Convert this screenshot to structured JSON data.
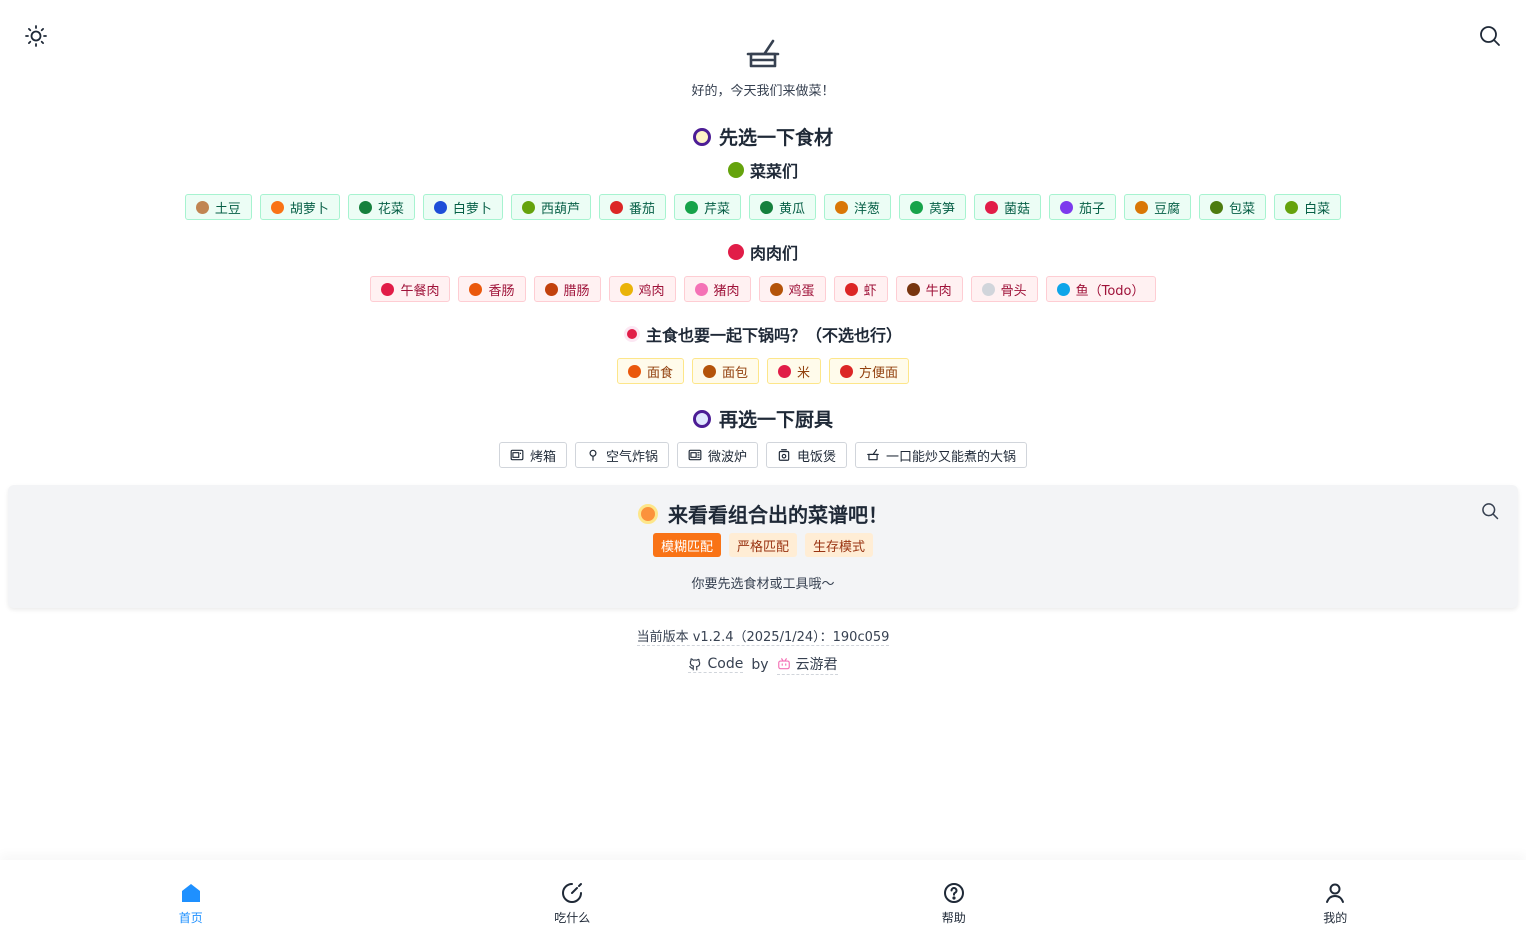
{
  "header": {
    "subtitle": "好的，今天我们来做菜！"
  },
  "ingredients": {
    "title": "先选一下食材",
    "vegetables": {
      "title": "菜菜们",
      "items": [
        "土豆",
        "胡萝卜",
        "花菜",
        "白萝卜",
        "西葫芦",
        "番茄",
        "芹菜",
        "黄瓜",
        "洋葱",
        "莴笋",
        "菌菇",
        "茄子",
        "豆腐",
        "包菜",
        "白菜"
      ],
      "icon_colors": [
        "#c08552",
        "#f97316",
        "#15803d",
        "#1d4ed8",
        "#65a30d",
        "#dc2626",
        "#16a34a",
        "#15803d",
        "#d97706",
        "#16a34a",
        "#e11d48",
        "#7c3aed",
        "#d97706",
        "#4d7c0f",
        "#65a30d"
      ]
    },
    "meats": {
      "title": "肉肉们",
      "items": [
        "午餐肉",
        "香肠",
        "腊肠",
        "鸡肉",
        "猪肉",
        "鸡蛋",
        "虾",
        "牛肉",
        "骨头",
        "鱼（Todo）"
      ],
      "icon_colors": [
        "#e11d48",
        "#ea580c",
        "#c2410c",
        "#eab308",
        "#f472b6",
        "#b45309",
        "#dc2626",
        "#78350f",
        "#d1d5db",
        "#0ea5e9"
      ]
    },
    "staples": {
      "title": "主食也要一起下锅吗？（不选也行）",
      "items": [
        "面食",
        "面包",
        "米",
        "方便面"
      ],
      "icon_colors": [
        "#ea580c",
        "#b45309",
        "#e11d48",
        "#dc2626"
      ]
    }
  },
  "tools": {
    "title": "再选一下厨具",
    "items": [
      {
        "label": "烤箱",
        "icon": "oven-icon"
      },
      {
        "label": "空气炸锅",
        "icon": "air-fryer-icon"
      },
      {
        "label": "微波炉",
        "icon": "microwave-icon"
      },
      {
        "label": "电饭煲",
        "icon": "rice-cooker-icon"
      },
      {
        "label": "一口能炒又能煮的大锅",
        "icon": "pot-icon"
      }
    ]
  },
  "recipes": {
    "title": "来看看组合出的菜谱吧！",
    "modes": [
      "模糊匹配",
      "严格匹配",
      "生存模式"
    ],
    "hint": "你要先选食材或工具哦～"
  },
  "footer": {
    "version": "当前版本 v1.2.4（2025/1/24）：190c059",
    "code_label": "Code",
    "by_label": "by",
    "author": "云游君"
  },
  "nav": {
    "items": [
      "首页",
      "吃什么",
      "帮助",
      "我的"
    ]
  },
  "colors": {
    "accent": "#1e90ff",
    "mode_active": "#f97316"
  }
}
